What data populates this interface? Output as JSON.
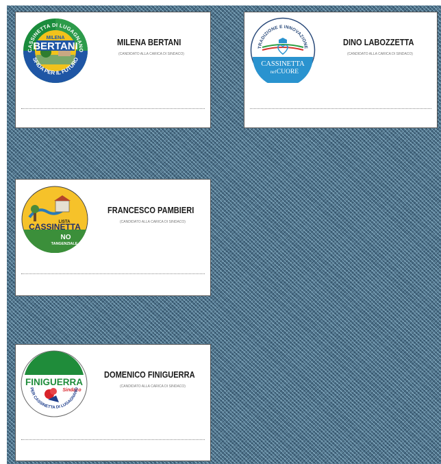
{
  "candidates": [
    {
      "name": "MILENA BERTANI",
      "role": "(CANDIDATO ALLA CARICA DI SINDACO)",
      "logo": {
        "arc_top": "CASSINETTA DI LUGAGNANO",
        "small": "MILENA",
        "main": "BERTANI",
        "arc_bottom": "SFIDA PER IL FUTURO",
        "colors": [
          "#1a8c3c",
          "#f2c21b",
          "#1f56a5"
        ]
      }
    },
    {
      "name": "DINO LABOZZETTA",
      "role": "(CANDIDATO ALLA CARICA DI SINDACO)",
      "logo": {
        "arc_top": "TRADIZIONE E INNOVAZIONE",
        "line1": "CASSINETTA",
        "line2_a": "nel",
        "line2_b": "CUORE",
        "colors": [
          "#2a93cf",
          "#e8e8f0",
          "#2ea043",
          "#d6342c"
        ]
      }
    },
    {
      "name": "FRANCESCO PAMBIERI",
      "role": "(CANDIDATO ALLA CARICA DI SINDACO)",
      "logo": {
        "small": "LISTA",
        "main": "CASSINETTA",
        "no": "NO",
        "sub": "TANGENZIALE",
        "colors": [
          "#f6c22a",
          "#3b8f3a",
          "#2a7ab8"
        ]
      }
    },
    {
      "name": "DOMENICO FINIGUERRA",
      "role": "(CANDIDATO ALLA CARICA DI SINDACO)",
      "logo": {
        "main": "FINIGUERRA",
        "small": "Sindaco",
        "arc_bottom": "PER CASSINETTA DI LUGAGNANO",
        "colors": [
          "#1f8c3a",
          "#d8232a",
          "#1f3f8c"
        ]
      }
    }
  ]
}
